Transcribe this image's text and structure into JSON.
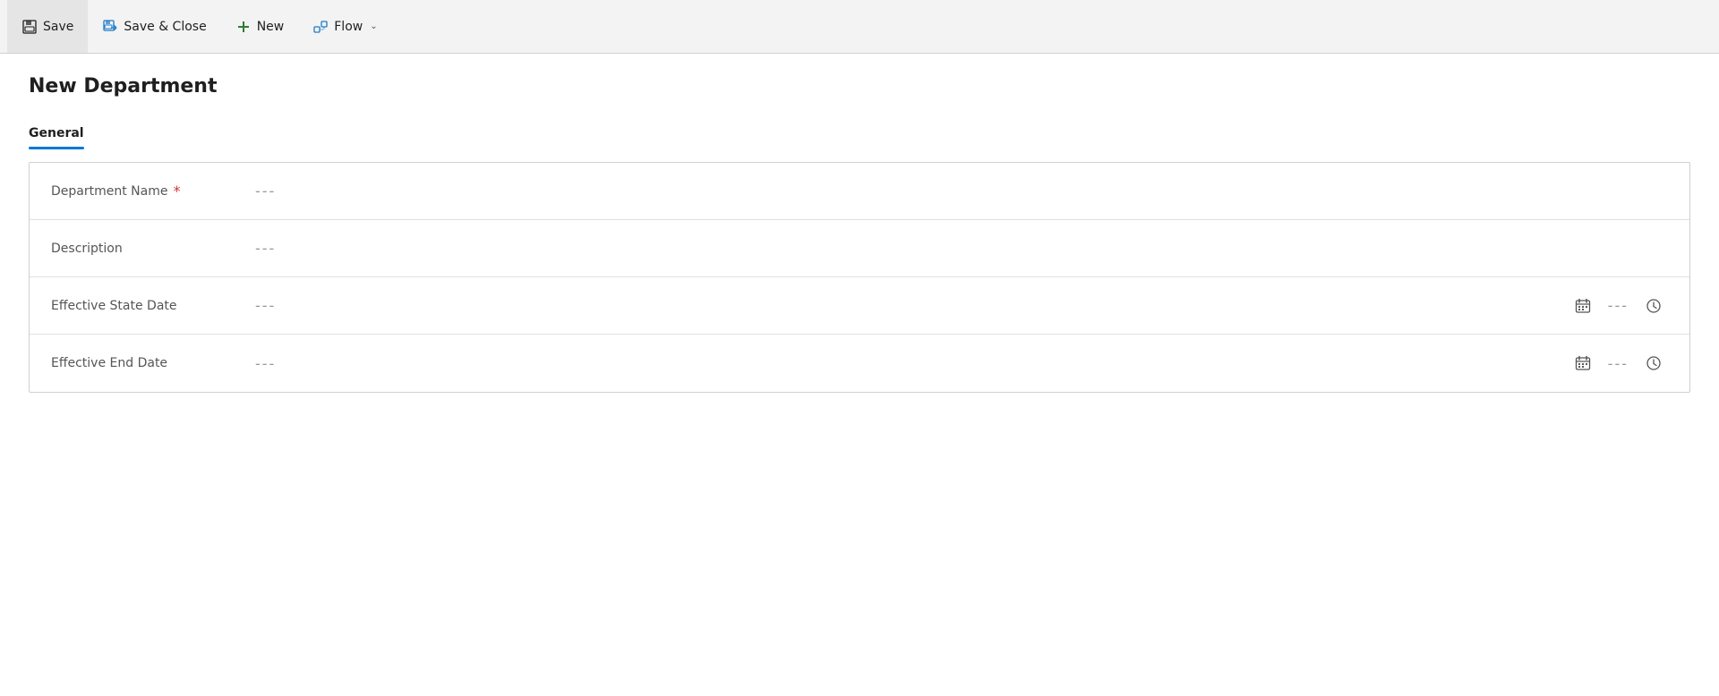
{
  "toolbar": {
    "save_label": "Save",
    "save_close_label": "Save & Close",
    "new_label": "New",
    "flow_label": "Flow"
  },
  "page": {
    "title": "New Department"
  },
  "tabs": [
    {
      "id": "general",
      "label": "General",
      "active": true
    }
  ],
  "form": {
    "fields": [
      {
        "id": "department-name",
        "label": "Department Name",
        "required": true,
        "value": "---",
        "type": "text"
      },
      {
        "id": "description",
        "label": "Description",
        "required": false,
        "value": "---",
        "type": "text"
      }
    ],
    "date_fields": [
      {
        "id": "effective-start-date",
        "label": "Effective State Date",
        "value": "---",
        "time_value": "---"
      },
      {
        "id": "effective-end-date",
        "label": "Effective End Date",
        "value": "---",
        "time_value": "---"
      }
    ]
  }
}
